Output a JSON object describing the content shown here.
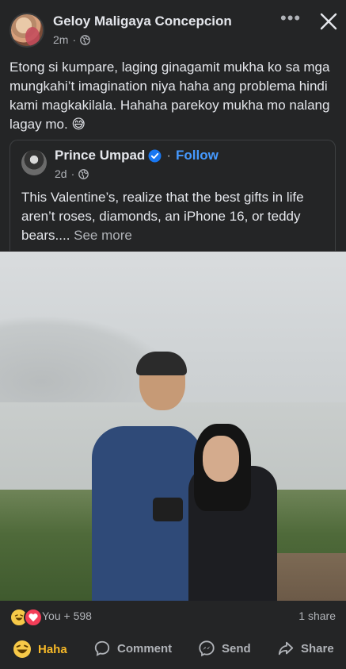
{
  "post": {
    "author": "Geloy Maligaya Concepcion",
    "time": "2m",
    "caption": "Etong si kumpare, laging ginagamit mukha ko sa mga mungkahi’t imagination niya haha ang problema hindi kami magkakilala. Hahaha parekoy mukha mo nalang lagay mo. 😅"
  },
  "shared": {
    "author": "Prince Umpad",
    "separator": "·",
    "follow_label": "Follow",
    "time": "2d",
    "text": "This Valentine’s, realize that the best gifts in life aren’t roses, diamonds, an iPhone 16, or teddy bears.... ",
    "see_more": "See more"
  },
  "reactions": {
    "summary": "You + 598",
    "shares": "1 share"
  },
  "actions": {
    "haha": "Haha",
    "comment": "Comment",
    "send": "Send",
    "share": "Share"
  },
  "colors": {
    "background": "#242526",
    "link": "#4599ff",
    "haha_active": "#f7b928",
    "muted": "#b0b3b8"
  }
}
